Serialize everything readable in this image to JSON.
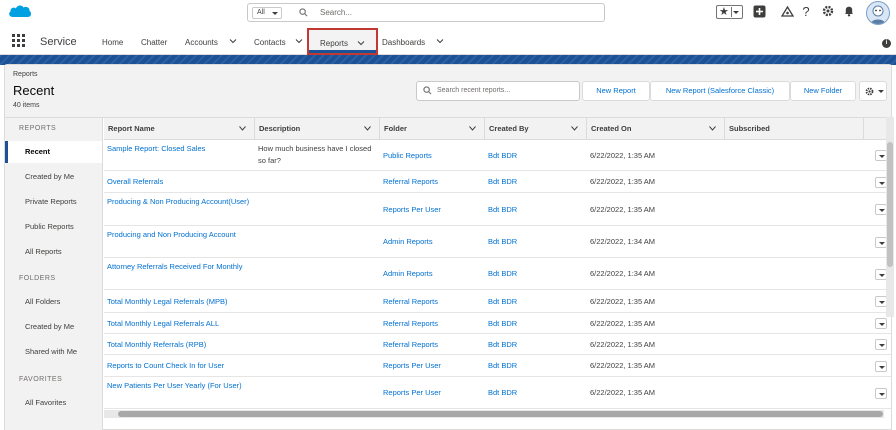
{
  "topbar": {
    "search_scope": "All",
    "search_placeholder": "Search..."
  },
  "nav": {
    "app_name": "Service",
    "items": [
      {
        "label": "Home",
        "has_menu": false
      },
      {
        "label": "Chatter",
        "has_menu": false
      },
      {
        "label": "Accounts",
        "has_menu": true
      },
      {
        "label": "Contacts",
        "has_menu": true
      },
      {
        "label": "Reports",
        "has_menu": true,
        "active": true
      },
      {
        "label": "Dashboards",
        "has_menu": true
      }
    ]
  },
  "header": {
    "breadcrumb": "Reports",
    "title": "Recent",
    "count": "40 items",
    "search_placeholder": "Search recent reports...",
    "buttons": [
      "New Report",
      "New Report (Salesforce Classic)",
      "New Folder"
    ]
  },
  "sidebar": {
    "sections": [
      {
        "title": "REPORTS",
        "items": [
          "Recent",
          "Created by Me",
          "Private Reports",
          "Public Reports",
          "All Reports"
        ]
      },
      {
        "title": "FOLDERS",
        "items": [
          "All Folders",
          "Created by Me",
          "Shared with Me"
        ]
      },
      {
        "title": "FAVORITES",
        "items": [
          "All Favorites"
        ]
      }
    ],
    "active": "Recent"
  },
  "table": {
    "columns": [
      "Report Name",
      "Description",
      "Folder",
      "Created By",
      "Created On",
      "Subscribed"
    ],
    "rows": [
      {
        "name": "Sample Report: Closed Sales",
        "description": "How much business have I closed so far?",
        "folder": "Public Reports",
        "created_by": "Bdt BDR",
        "created_on": "6/22/2022, 1:35 AM"
      },
      {
        "name": "Overall Referrals",
        "description": "",
        "folder": "Referral Reports",
        "created_by": "Bdt BDR",
        "created_on": "6/22/2022, 1:35 AM"
      },
      {
        "name": "Producing & Non Producing Account(User)",
        "description": "",
        "folder": "Reports Per User",
        "created_by": "Bdt BDR",
        "created_on": "6/22/2022, 1:35 AM"
      },
      {
        "name": "Producing and Non Producing Account",
        "description": "",
        "folder": "Admin Reports",
        "created_by": "Bdt BDR",
        "created_on": "6/22/2022, 1:34 AM"
      },
      {
        "name": "Attorney Referrals Received For Monthly",
        "description": "",
        "folder": "Admin Reports",
        "created_by": "Bdt BDR",
        "created_on": "6/22/2022, 1:34 AM"
      },
      {
        "name": "Total Monthly Legal Referrals (MPB)",
        "description": "",
        "folder": "Referral Reports",
        "created_by": "Bdt BDR",
        "created_on": "6/22/2022, 1:35 AM"
      },
      {
        "name": "Total Monthly Legal Referrals ALL",
        "description": "",
        "folder": "Referral Reports",
        "created_by": "Bdt BDR",
        "created_on": "6/22/2022, 1:35 AM"
      },
      {
        "name": "Total Monthly Referrals (RPB)",
        "description": "",
        "folder": "Referral Reports",
        "created_by": "Bdt BDR",
        "created_on": "6/22/2022, 1:35 AM"
      },
      {
        "name": "Reports to Count Check In for User",
        "description": "",
        "folder": "Reports Per User",
        "created_by": "Bdt BDR",
        "created_on": "6/22/2022, 1:35 AM"
      },
      {
        "name": "New Patients Per User Yearly (For User)",
        "description": "",
        "folder": "Reports Per User",
        "created_by": "Bdt BDR",
        "created_on": "6/22/2022, 1:35 AM"
      }
    ]
  }
}
